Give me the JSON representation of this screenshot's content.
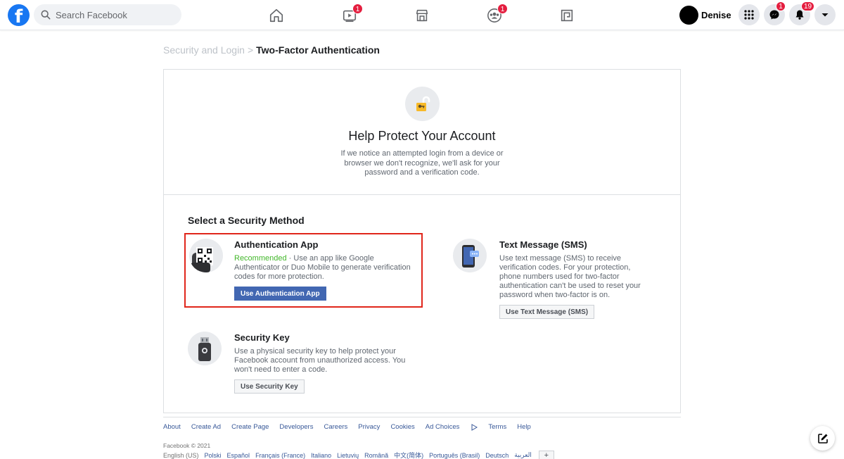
{
  "topbar": {
    "logo_letter": "f",
    "search_placeholder": "Search Facebook",
    "nav": [
      {
        "name": "home",
        "badge": ""
      },
      {
        "name": "watch",
        "badge": "1"
      },
      {
        "name": "marketplace",
        "badge": ""
      },
      {
        "name": "groups",
        "badge": "1"
      },
      {
        "name": "gaming",
        "badge": ""
      }
    ],
    "profile_name": "Denise",
    "messenger_badge": "1",
    "notifications_badge": "19"
  },
  "breadcrumb": {
    "parent": "Security and Login",
    "separator": ">",
    "current": "Two-Factor Authentication"
  },
  "hero": {
    "title": "Help Protect Your Account",
    "description": "If we notice an attempted login from a device or browser we don't recognize, we'll ask for your password and a verification code."
  },
  "methods_section": {
    "title": "Select a Security Method",
    "auth_app": {
      "title": "Authentication App",
      "recommended": "Recommended",
      "description": " · Use an app like Google Authenticator or Duo Mobile to generate verification codes for more protection.",
      "button": "Use Authentication App"
    },
    "sms": {
      "title": "Text Message (SMS)",
      "description": "Use text message (SMS) to receive verification codes. For your protection, phone numbers used for two-factor authentication can't be used to reset your password when two-factor is on.",
      "button": "Use Text Message (SMS)"
    },
    "security_key": {
      "title": "Security Key",
      "description": "Use a physical security key to help protect your Facebook account from unauthorized access. You won't need to enter a code.",
      "button": "Use Security Key"
    }
  },
  "footer": {
    "links": [
      "About",
      "Create Ad",
      "Create Page",
      "Developers",
      "Careers",
      "Privacy",
      "Cookies",
      "Ad Choices",
      "Terms",
      "Help"
    ],
    "copyright": "Facebook © 2021",
    "languages": [
      "English (US)",
      "Polski",
      "Español",
      "Français (France)",
      "Italiano",
      "Lietuvių",
      "Română",
      "中文(简体)",
      "Português (Brasil)",
      "Deutsch",
      "العربية"
    ],
    "add_language": "+"
  },
  "colors": {
    "brand": "#1877f2",
    "primary_button": "#4267b2",
    "recommended": "#42b72a",
    "highlight": "#e0261b",
    "badge": "#e41e3f"
  }
}
